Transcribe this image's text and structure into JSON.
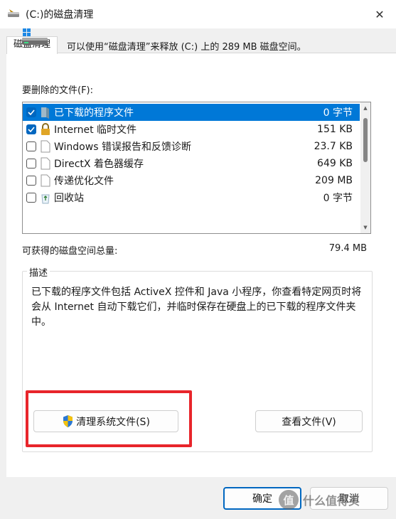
{
  "window": {
    "title": "(C:)的磁盘清理",
    "close_glyph": "✕"
  },
  "tabs": [
    {
      "label": "磁盘清理"
    }
  ],
  "intro": "可以使用“磁盘清理”来释放 (C:) 上的 289 MB 磁盘空间。",
  "files_label": "要删除的文件(F):",
  "files": [
    {
      "name": "已下载的程序文件",
      "size": "0 字节",
      "checked": true,
      "selected": true,
      "icon": "folder-icon"
    },
    {
      "name": "Internet 临时文件",
      "size": "151 KB",
      "checked": true,
      "selected": false,
      "icon": "lock-icon"
    },
    {
      "name": "Windows 错误报告和反馈诊断",
      "size": "23.7 KB",
      "checked": false,
      "selected": false,
      "icon": "file-icon"
    },
    {
      "name": "DirectX 着色器缓存",
      "size": "649 KB",
      "checked": false,
      "selected": false,
      "icon": "file-icon"
    },
    {
      "name": "传递优化文件",
      "size": "209 MB",
      "checked": false,
      "selected": false,
      "icon": "file-icon"
    },
    {
      "name": "回收站",
      "size": "0 字节",
      "checked": false,
      "selected": false,
      "icon": "recycle-bin-icon"
    }
  ],
  "total": {
    "label": "可获得的磁盘空间总量:",
    "value": "79.4 MB"
  },
  "description": {
    "legend": "描述",
    "text": "已下载的程序文件包括 ActiveX 控件和 Java 小程序，你查看特定网页时将会从 Internet 自动下载它们，并临时保存在硬盘上的已下载的程序文件夹中。"
  },
  "buttons": {
    "cleanup_system": "清理系统文件(S)",
    "view_files": "查看文件(V)",
    "ok": "确定",
    "cancel": "取消"
  },
  "watermark": {
    "glyph": "值",
    "text": "什么值得买"
  },
  "colors": {
    "selection": "#0078d7",
    "highlight": "#e8252b",
    "accent": "#0067c0"
  }
}
